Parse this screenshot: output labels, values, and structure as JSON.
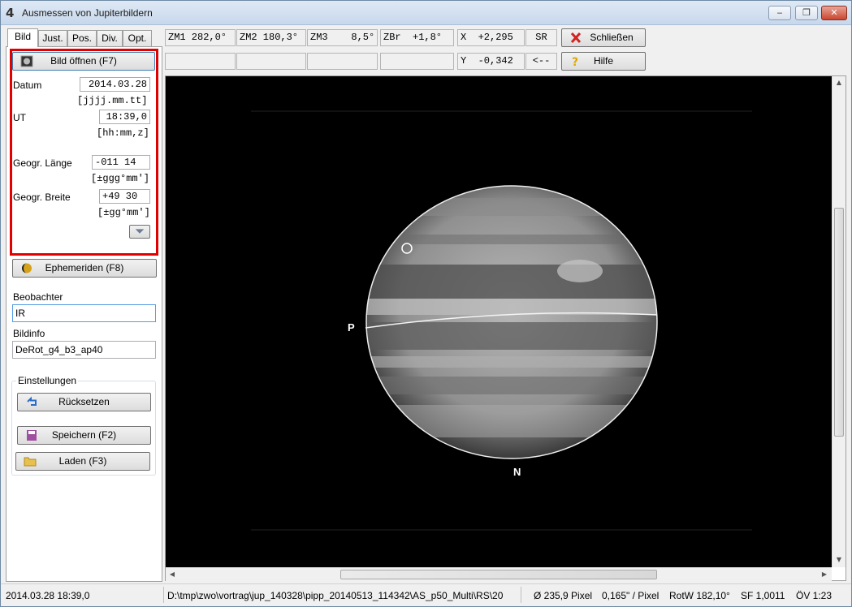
{
  "window": {
    "title": "Ausmessen von Jupiterbildern",
    "minimize": "‒",
    "maximize": "❐",
    "close": "✕"
  },
  "tabs": [
    "Bild",
    "Just.",
    "Pos.",
    "Div.",
    "Opt."
  ],
  "bild_tab": {
    "open_button": "Bild öffnen (F7)",
    "datum_label": "Datum",
    "datum_value": "2014.03.28",
    "datum_format": "[jjjj.mm.tt]",
    "ut_label": "UT",
    "ut_value": "18:39,0",
    "ut_format": "[hh:mm,z]",
    "laenge_label": "Geogr. Länge",
    "laenge_value": "-011 14",
    "laenge_format": "[±ggg°mm']",
    "breite_label": "Geogr. Breite",
    "breite_value": "+49 30",
    "breite_format": "[±gg°mm']",
    "ephem_button": "Ephemeriden (F8)",
    "beobachter_label": "Beobachter",
    "beobachter_value": "IR",
    "bildinfo_label": "Bildinfo",
    "bildinfo_value": "DeRot_g4_b3_ap40",
    "einstellungen_label": "Einstellungen",
    "reset_button": "Rücksetzen",
    "save_button": "Speichern (F2)",
    "load_button": "Laden (F3)"
  },
  "readouts": {
    "zm1": "ZM1 282,0°",
    "zm2": "ZM2 180,3°",
    "zm3": "ZM3    8,5°",
    "zbr": "ZBr  +1,8°",
    "x": "X  +2,295",
    "y": "Y  -0,342",
    "sr": "SR",
    "back": "<--"
  },
  "buttons": {
    "close": "Schließen",
    "help": "Hilfe"
  },
  "image": {
    "label_p": "P",
    "label_n": "N"
  },
  "status": {
    "datetime": "2014.03.28   18:39,0",
    "path": "D:\\tmp\\zwo\\vortrag\\jup_140328\\pipp_20140513_114342\\AS_p50_Multi\\RS\\20",
    "diameter": "Ø 235,9 Pixel",
    "scale": "0,165\" / Pixel",
    "rotw": "RotW 182,10°",
    "sf": "SF 1,0011",
    "ov": "ÖV 1:23"
  },
  "colors": {
    "highlight_border": "#e00000",
    "close_icon": "#d32222",
    "help_icon": "#e0a800"
  }
}
